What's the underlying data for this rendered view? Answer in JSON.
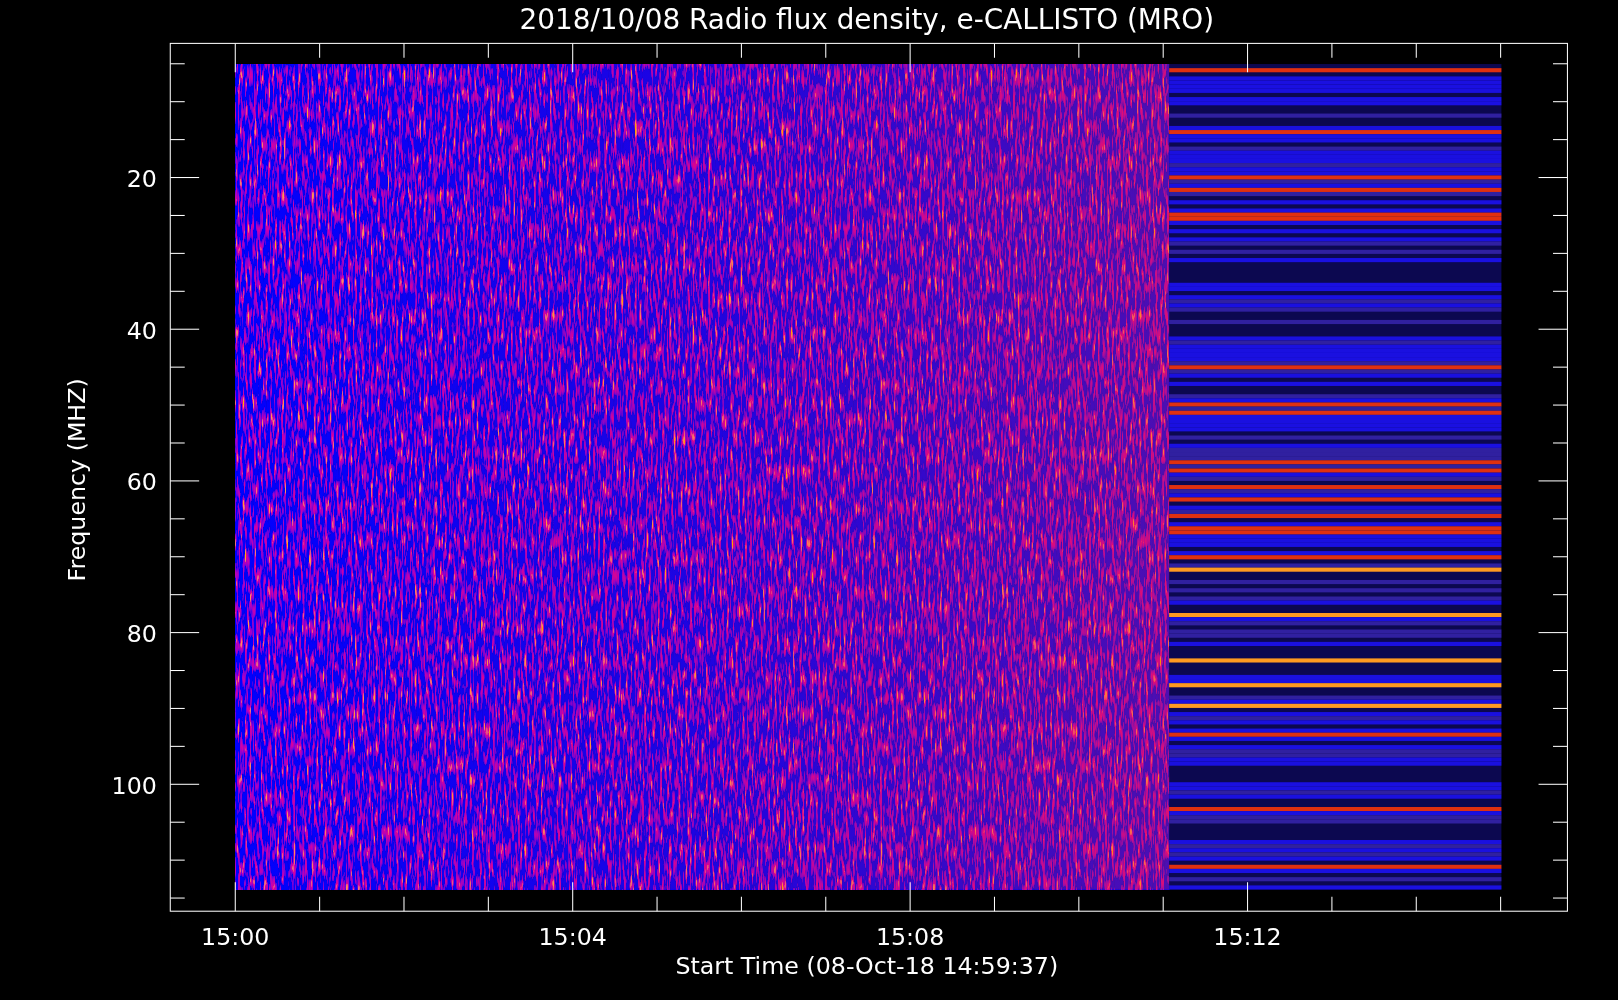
{
  "title": "2018/10/08  Radio flux density, e-CALLISTO (MRO)",
  "y_axis": {
    "label": "Frequency (MHZ)",
    "ticks": [
      "20",
      "40",
      "60",
      "80",
      "100"
    ]
  },
  "x_axis": {
    "label": "Start Time (08-Oct-18 14:59:37)",
    "ticks": [
      "15:00",
      "15:04",
      "15:08",
      "15:12"
    ]
  }
}
